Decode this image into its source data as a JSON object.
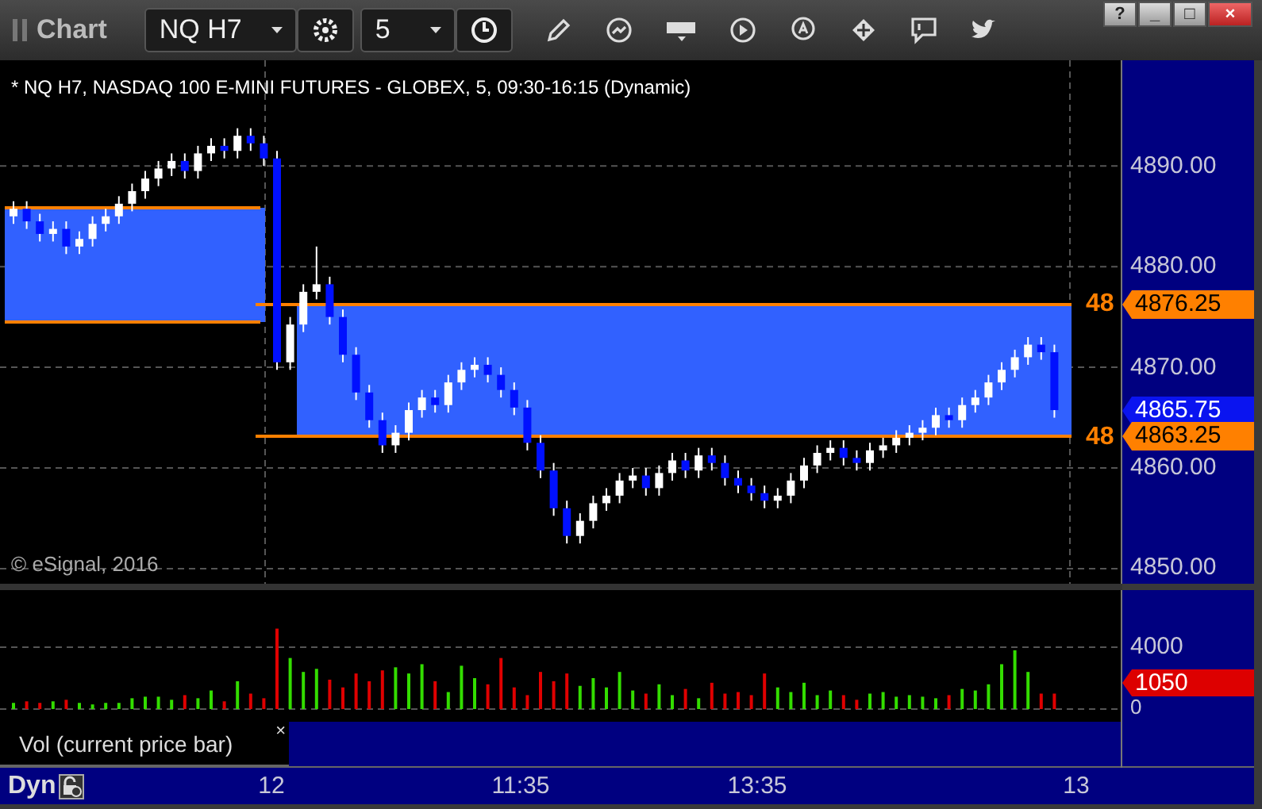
{
  "window": {
    "title": "Chart",
    "controls": [
      "?",
      "_",
      "□",
      "×"
    ]
  },
  "toolbar": {
    "symbol": "NQ H7",
    "interval": "5"
  },
  "chart": {
    "caption": "* NQ H7, NASDAQ 100 E-MINI FUTURES - GLOBEX, 5, 09:30-16:15 (Dynamic)",
    "copyright": "© eSignal, 2016",
    "chart_data": {
      "type": "candlestick",
      "grid": true,
      "ylim": [
        4848.5,
        4900.5
      ],
      "yticks": [
        {
          "value": 4890,
          "label": "4890.00"
        },
        {
          "value": 4880,
          "label": "4880.00"
        },
        {
          "value": 4870,
          "label": "4870.00"
        },
        {
          "value": 4860,
          "label": "4860.00"
        },
        {
          "value": 4850,
          "label": "4850.00"
        }
      ],
      "ohlc": [
        [
          4885.0,
          4886.5,
          4884.25,
          4885.75
        ],
        [
          4885.75,
          4886.5,
          4883.75,
          4884.5
        ],
        [
          4884.5,
          4885.25,
          4882.5,
          4883.25
        ],
        [
          4883.25,
          4884.5,
          4882.5,
          4883.75
        ],
        [
          4883.75,
          4884.5,
          4881.25,
          4882.0
        ],
        [
          4882.0,
          4883.5,
          4881.25,
          4882.75
        ],
        [
          4882.75,
          4885.0,
          4882.0,
          4884.25
        ],
        [
          4884.25,
          4885.75,
          4883.5,
          4885.0
        ],
        [
          4885.0,
          4887.0,
          4884.25,
          4886.25
        ],
        [
          4886.25,
          4888.25,
          4885.5,
          4887.5
        ],
        [
          4887.5,
          4889.5,
          4886.75,
          4888.75
        ],
        [
          4888.75,
          4890.5,
          4888.0,
          4889.75
        ],
        [
          4889.75,
          4891.25,
          4889.0,
          4890.5
        ],
        [
          4890.5,
          4891.25,
          4888.75,
          4889.5
        ],
        [
          4889.5,
          4892.0,
          4888.75,
          4891.25
        ],
        [
          4891.25,
          4892.75,
          4890.5,
          4892.0
        ],
        [
          4892.0,
          4892.75,
          4890.75,
          4891.5
        ],
        [
          4891.5,
          4893.75,
          4890.75,
          4893.0
        ],
        [
          4893.0,
          4893.75,
          4891.5,
          4892.25
        ],
        [
          4892.25,
          4893.0,
          4890.0,
          4890.75
        ],
        [
          4890.75,
          4891.5,
          4869.75,
          4870.5
        ],
        [
          4870.5,
          4875.0,
          4869.75,
          4874.25
        ],
        [
          4874.25,
          4878.25,
          4873.5,
          4877.5
        ],
        [
          4877.5,
          4882.0,
          4876.75,
          4878.25
        ],
        [
          4878.25,
          4879.0,
          4874.25,
          4875.0
        ],
        [
          4875.0,
          4875.75,
          4870.5,
          4871.25
        ],
        [
          4871.25,
          4872.0,
          4866.75,
          4867.5
        ],
        [
          4867.5,
          4868.25,
          4864.0,
          4864.75
        ],
        [
          4864.75,
          4865.5,
          4861.5,
          4862.25
        ],
        [
          4862.25,
          4864.25,
          4861.5,
          4863.5
        ],
        [
          4863.5,
          4866.5,
          4862.75,
          4865.75
        ],
        [
          4865.75,
          4867.75,
          4865.0,
          4867.0
        ],
        [
          4867.0,
          4867.75,
          4865.5,
          4866.25
        ],
        [
          4866.25,
          4869.25,
          4865.5,
          4868.5
        ],
        [
          4868.5,
          4870.5,
          4867.75,
          4869.75
        ],
        [
          4869.75,
          4871.0,
          4869.0,
          4870.25
        ],
        [
          4870.25,
          4871.0,
          4868.5,
          4869.25
        ],
        [
          4869.25,
          4870.0,
          4867.0,
          4867.75
        ],
        [
          4867.75,
          4868.5,
          4865.25,
          4866.0
        ],
        [
          4866.0,
          4866.75,
          4861.75,
          4862.5
        ],
        [
          4862.5,
          4863.25,
          4859.0,
          4859.75
        ],
        [
          4859.75,
          4860.5,
          4855.25,
          4856.0
        ],
        [
          4856.0,
          4856.75,
          4852.5,
          4853.25
        ],
        [
          4853.25,
          4855.5,
          4852.5,
          4854.75
        ],
        [
          4854.75,
          4857.25,
          4854.0,
          4856.5
        ],
        [
          4856.5,
          4858.0,
          4855.75,
          4857.25
        ],
        [
          4857.25,
          4859.5,
          4856.5,
          4858.75
        ],
        [
          4858.75,
          4860.0,
          4858.0,
          4859.25
        ],
        [
          4859.25,
          4860.0,
          4857.25,
          4858.0
        ],
        [
          4858.0,
          4860.25,
          4857.25,
          4859.5
        ],
        [
          4859.5,
          4861.5,
          4858.75,
          4860.75
        ],
        [
          4860.75,
          4861.5,
          4859.0,
          4859.75
        ],
        [
          4859.75,
          4862.0,
          4859.0,
          4861.25
        ],
        [
          4861.25,
          4862.0,
          4859.75,
          4860.5
        ],
        [
          4860.5,
          4861.25,
          4858.25,
          4859.0
        ],
        [
          4859.0,
          4859.75,
          4857.5,
          4858.25
        ],
        [
          4858.25,
          4859.0,
          4856.75,
          4857.5
        ],
        [
          4857.5,
          4858.25,
          4856.0,
          4856.75
        ],
        [
          4856.75,
          4858.0,
          4856.0,
          4857.25
        ],
        [
          4857.25,
          4859.5,
          4856.5,
          4858.75
        ],
        [
          4858.75,
          4861.0,
          4858.0,
          4860.25
        ],
        [
          4860.25,
          4862.25,
          4859.5,
          4861.5
        ],
        [
          4861.5,
          4862.75,
          4860.75,
          4862.0
        ],
        [
          4862.0,
          4862.75,
          4860.25,
          4861.0
        ],
        [
          4861.0,
          4861.75,
          4859.75,
          4860.5
        ],
        [
          4860.5,
          4862.5,
          4859.75,
          4861.75
        ],
        [
          4861.75,
          4863.0,
          4861.0,
          4862.25
        ],
        [
          4862.25,
          4863.75,
          4861.5,
          4863.0
        ],
        [
          4863.0,
          4864.25,
          4862.25,
          4863.5
        ],
        [
          4863.5,
          4864.75,
          4862.75,
          4864.0
        ],
        [
          4864.0,
          4866.0,
          4863.25,
          4865.25
        ],
        [
          4865.25,
          4866.0,
          4864.0,
          4864.75
        ],
        [
          4864.75,
          4867.0,
          4864.0,
          4866.25
        ],
        [
          4866.25,
          4867.75,
          4865.5,
          4867.0
        ],
        [
          4867.0,
          4869.25,
          4866.25,
          4868.5
        ],
        [
          4868.5,
          4870.5,
          4867.75,
          4869.75
        ],
        [
          4869.75,
          4871.75,
          4869.0,
          4871.0
        ],
        [
          4871.0,
          4873.0,
          4870.25,
          4872.25
        ],
        [
          4872.25,
          4873.0,
          4870.75,
          4871.5
        ],
        [
          4871.5,
          4872.25,
          4865.0,
          4865.75
        ]
      ]
    },
    "line_labels": [
      "48",
      "48"
    ],
    "price_tags": [
      {
        "text": "4876.25",
        "color": "#ff8000"
      },
      {
        "text": "4865.75",
        "color": "#0a14f0"
      },
      {
        "text": "4863.25",
        "color": "#ff8000"
      }
    ]
  },
  "volume": {
    "study": "Vol (current price bar)",
    "close": "×",
    "chart_data": {
      "type": "bar",
      "grid": true,
      "ylim": [
        -820,
        7690
      ],
      "yticks": [
        {
          "value": 4000,
          "label": "4000"
        },
        {
          "value": 0,
          "label": "0"
        }
      ],
      "series": [
        {
          "color": "#33dd00",
          "values": [
            400,
            null,
            null,
            500,
            null,
            400,
            300,
            400,
            400,
            700,
            800,
            800,
            600,
            null,
            700,
            1200,
            null,
            1800,
            null,
            null,
            null,
            3300,
            2400,
            2600,
            null,
            null,
            null,
            null,
            null,
            2700,
            2300,
            2900,
            null,
            1100,
            2800,
            2000,
            null,
            null,
            null,
            null,
            null,
            null,
            null,
            1500,
            2000,
            1400,
            2400,
            1200,
            null,
            1600,
            900,
            null,
            700,
            null,
            null,
            null,
            null,
            null,
            1400,
            1100,
            1700,
            900,
            1200,
            null,
            null,
            1000,
            1100,
            800,
            900,
            800,
            700,
            null,
            1300,
            1200,
            1600,
            2900,
            3800,
            2400,
            null,
            null
          ]
        },
        {
          "color": "#e00000",
          "values": [
            null,
            500,
            400,
            null,
            600,
            null,
            null,
            null,
            null,
            null,
            null,
            null,
            null,
            900,
            null,
            null,
            500,
            null,
            1000,
            700,
            5200,
            null,
            null,
            null,
            1900,
            1400,
            2300,
            1800,
            2500,
            null,
            null,
            null,
            1800,
            null,
            null,
            null,
            1600,
            3300,
            1400,
            900,
            2400,
            1800,
            2300,
            null,
            null,
            null,
            null,
            null,
            1000,
            null,
            null,
            1300,
            null,
            1700,
            1000,
            1100,
            900,
            2300,
            null,
            null,
            null,
            null,
            null,
            900,
            600,
            null,
            null,
            null,
            null,
            null,
            null,
            900,
            null,
            null,
            null,
            null,
            null,
            null,
            1000,
            1000
          ]
        }
      ]
    },
    "tag": {
      "text": "1050",
      "color": "#dd0000"
    }
  },
  "time_axis": {
    "mode": "Dyn",
    "ticks": [
      "12",
      "11:35",
      "13:35",
      "13"
    ]
  }
}
